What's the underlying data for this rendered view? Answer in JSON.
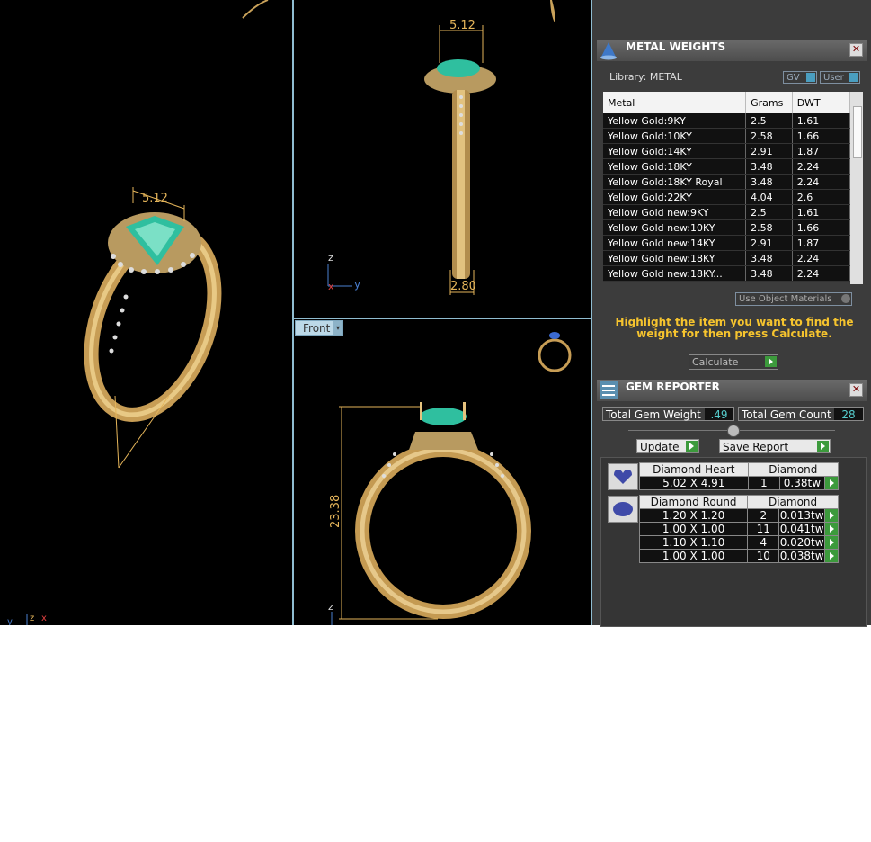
{
  "viewports": {
    "front_tab": "Front",
    "side_dims": {
      "top": "5.12",
      "bottom": "2.80"
    },
    "front_dims": {
      "height": "23.38"
    },
    "persp_dims": {
      "top": "5.12"
    },
    "axes": {
      "z": "z",
      "y": "y",
      "x": "x"
    }
  },
  "metal_weights": {
    "title": "METAL WEIGHTS",
    "library_label": "Library: METAL",
    "gv_label": "GV",
    "user_label": "User",
    "columns": [
      "Metal",
      "Grams",
      "DWT"
    ],
    "rows": [
      [
        "Yellow Gold:9KY",
        "2.5",
        "1.61"
      ],
      [
        "Yellow Gold:10KY",
        "2.58",
        "1.66"
      ],
      [
        "Yellow Gold:14KY",
        "2.91",
        "1.87"
      ],
      [
        "Yellow Gold:18KY",
        "3.48",
        "2.24"
      ],
      [
        "Yellow Gold:18KY Royal",
        "3.48",
        "2.24"
      ],
      [
        "Yellow Gold:22KY",
        "4.04",
        "2.6"
      ],
      [
        "Yellow Gold new:9KY",
        "2.5",
        "1.61"
      ],
      [
        "Yellow Gold new:10KY",
        "2.58",
        "1.66"
      ],
      [
        "Yellow Gold new:14KY",
        "2.91",
        "1.87"
      ],
      [
        "Yellow Gold new:18KY",
        "3.48",
        "2.24"
      ],
      [
        "Yellow Gold new:18KY...",
        "3.48",
        "2.24"
      ]
    ],
    "use_object_materials": "Use Object Materials",
    "hint": "Highlight the item you want to find the weight for then press Calculate.",
    "calculate": "Calculate"
  },
  "gem_reporter": {
    "title": "GEM REPORTER",
    "total_weight_label": "Total Gem Weight",
    "total_weight": ".49",
    "total_count_label": "Total Gem Count",
    "total_count": "28",
    "update": "Update",
    "save_report": "Save Report",
    "groups": [
      {
        "shape": "Diamond Heart",
        "material": "Diamond",
        "rows": [
          [
            "5.02 X 4.91",
            "1",
            "0.38tw"
          ]
        ]
      },
      {
        "shape": "Diamond Round",
        "material": "Diamond",
        "rows": [
          [
            "1.20 X 1.20",
            "2",
            "0.013tw"
          ],
          [
            "1.00 X 1.00",
            "11",
            "0.041tw"
          ],
          [
            "1.10 X 1.10",
            "4",
            "0.020tw"
          ],
          [
            "1.00 X 1.00",
            "10",
            "0.038tw"
          ]
        ]
      }
    ]
  }
}
